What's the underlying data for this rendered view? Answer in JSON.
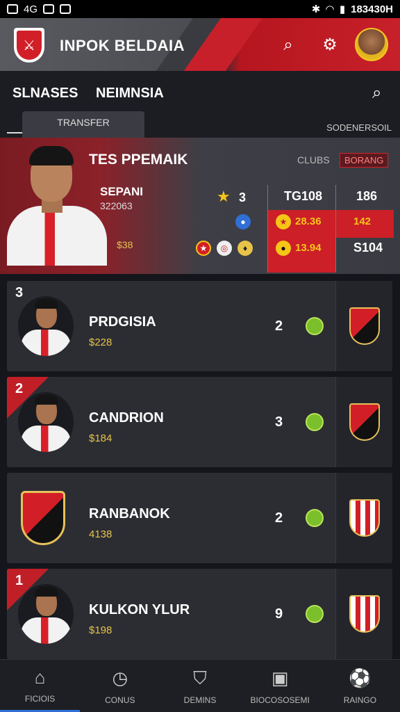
{
  "status_bar": {
    "left_text": "4G",
    "right_text": "183430H"
  },
  "header": {
    "title": "INPOK BELDAIA"
  },
  "subnav": {
    "tab_left": "SLNASES",
    "tab_right": "NEIMNSIA",
    "active_tab": "TRANSFER",
    "right_label": "SODENERSOIL"
  },
  "featured": {
    "name": "TES PPEMAIK",
    "clubs_label": "CLUBS",
    "badge": "BORANG",
    "sub1": "SEPANI",
    "sub2": "322063",
    "value": "$38",
    "stars": "3",
    "col1_head": "TG108",
    "col1_mid": "28.36",
    "col1_low": "13.94",
    "col2_head": "186",
    "col2_mid": "142",
    "col2_low": "S104"
  },
  "rows": [
    {
      "rank": "3",
      "name": "PRDGISIA",
      "value": "$228",
      "count": "2"
    },
    {
      "rank": "2",
      "name": "CANDRION",
      "value": "$184",
      "count": "3"
    },
    {
      "rank": "",
      "name": "RANBANOK",
      "value": "4138",
      "count": "2"
    },
    {
      "rank": "1",
      "name": "KULKON YLUR",
      "value": "$198",
      "count": "9"
    }
  ],
  "bottom_nav": [
    {
      "label": "FICIOIS",
      "icon": "home-icon"
    },
    {
      "label": "CONUS",
      "icon": "clock-icon"
    },
    {
      "label": "DEMINS",
      "icon": "shield-icon"
    },
    {
      "label": "BIOCOSOSEMI",
      "icon": "tv-icon"
    },
    {
      "label": "RAINGO",
      "icon": "ball-icon"
    }
  ],
  "colors": {
    "accent_red": "#cc1f27",
    "gold": "#e7c34a",
    "green": "#7bbf2a"
  }
}
